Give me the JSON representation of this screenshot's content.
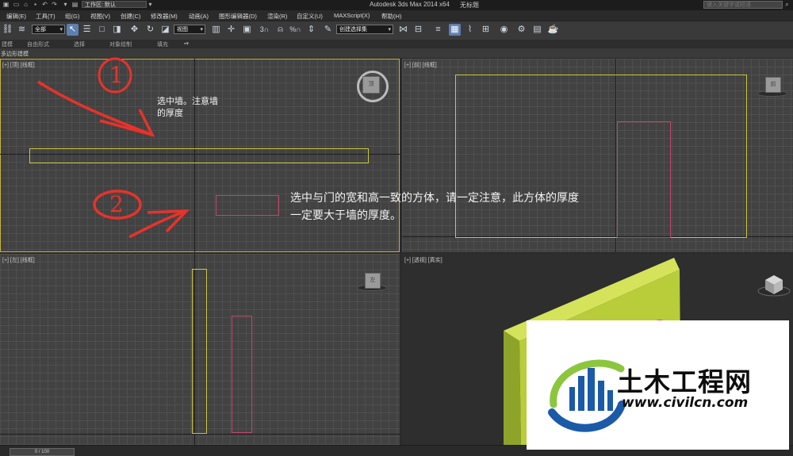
{
  "titlebar": {
    "workspace": "工作区: 默认",
    "app_title": "Autodesk 3ds Max  2014 x64",
    "doc_title": "无标题",
    "search_placeholder": "键入关键字或短语"
  },
  "menu": [
    "编辑(E)",
    "工具(T)",
    "组(G)",
    "视图(V)",
    "创建(C)",
    "修改器(M)",
    "动画(A)",
    "图形编辑器(D)",
    "渲染(R)",
    "自定义(U)",
    "MAXScript(X)",
    "帮助(H)"
  ],
  "toolbar": {
    "selection_filter": "全部",
    "reference_coord": "视图",
    "named_selection": "创建选择集"
  },
  "ribbon": {
    "tabs": [
      "建模",
      "自由形式",
      "选择",
      "对象绘制",
      "填充"
    ],
    "panel_label": "多边形建模"
  },
  "viewports": {
    "top": {
      "label": "[+] [顶] [线框]"
    },
    "front": {
      "label": "[+] [前] [线框]"
    },
    "left": {
      "label": "[+] [左] [线框]"
    },
    "perspective": {
      "label": "[+] [透视] [真实]"
    }
  },
  "viewcube_faces": {
    "top": "顶",
    "front": "前",
    "left": "左"
  },
  "annotations": {
    "circle_1": "1",
    "circle_2": "2",
    "note_1_line1": "选中墙。注意墙",
    "note_1_line2": "的厚度",
    "note_2_line1": "选中与门的宽和高一致的方体，请一定注意，此方体的厚度",
    "note_2_line2": "一定要大于墙的厚度。"
  },
  "status": {
    "frame": "0 / 100"
  },
  "watermark": {
    "name": "土木工程网",
    "url": "www.civilcn.com"
  },
  "colors": {
    "selection_yellow": "#c9c83e",
    "box_pink": "#c4456a",
    "wall_green": "#b9cc3a",
    "annotation_red": "#e8322a",
    "logo_blue": "#1b5aa8",
    "logo_green": "#8cc63f"
  }
}
